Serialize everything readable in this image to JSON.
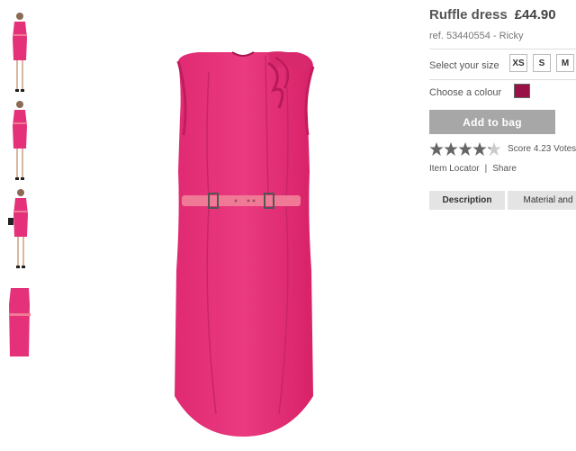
{
  "product": {
    "title": "Ruffle dress",
    "price": "£44.90",
    "ref": "ref. 53440554 - Ricky"
  },
  "size": {
    "label": "Select your size",
    "options": [
      "XS",
      "S",
      "M"
    ]
  },
  "colour": {
    "label": "Choose a colour",
    "selected_hex": "#9a1148"
  },
  "add_to_bag": "Add to bag",
  "rating": {
    "stars_value": 4.23,
    "stars_max": 5,
    "score_text": "Score 4.23 Votes"
  },
  "links": {
    "item_locator": "Item Locator",
    "separator": "|",
    "share": "Share"
  },
  "tabs": [
    {
      "label": "Description"
    },
    {
      "label": "Material and"
    }
  ],
  "colors": {
    "dress_pink": "#e4317a",
    "dress_shadow": "#c9246a",
    "belt_pink": "#f07a95",
    "button_gray": "#a7a7a7"
  }
}
